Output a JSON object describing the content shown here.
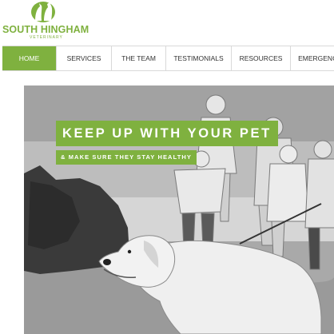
{
  "logo": {
    "name": "SOUTH HINGHAM",
    "subtitle": "VETERINARY",
    "icon": "cat-and-dog-silhouette-icon",
    "color": "#7fb13f"
  },
  "nav": {
    "active_color": "#7fb13f",
    "items": [
      {
        "label": "HOME",
        "active": true
      },
      {
        "label": "SERVICES",
        "active": false
      },
      {
        "label": "THE TEAM",
        "active": false
      },
      {
        "label": "TESTIMONIALS",
        "active": false
      },
      {
        "label": "RESOURCES",
        "active": false
      },
      {
        "label": "EMERGENCY",
        "active": false
      }
    ]
  },
  "hero": {
    "title": "KEEP UP WITH YOUR PET",
    "subtitle": "& MAKE SURE THEY STAY HEALTHY"
  }
}
